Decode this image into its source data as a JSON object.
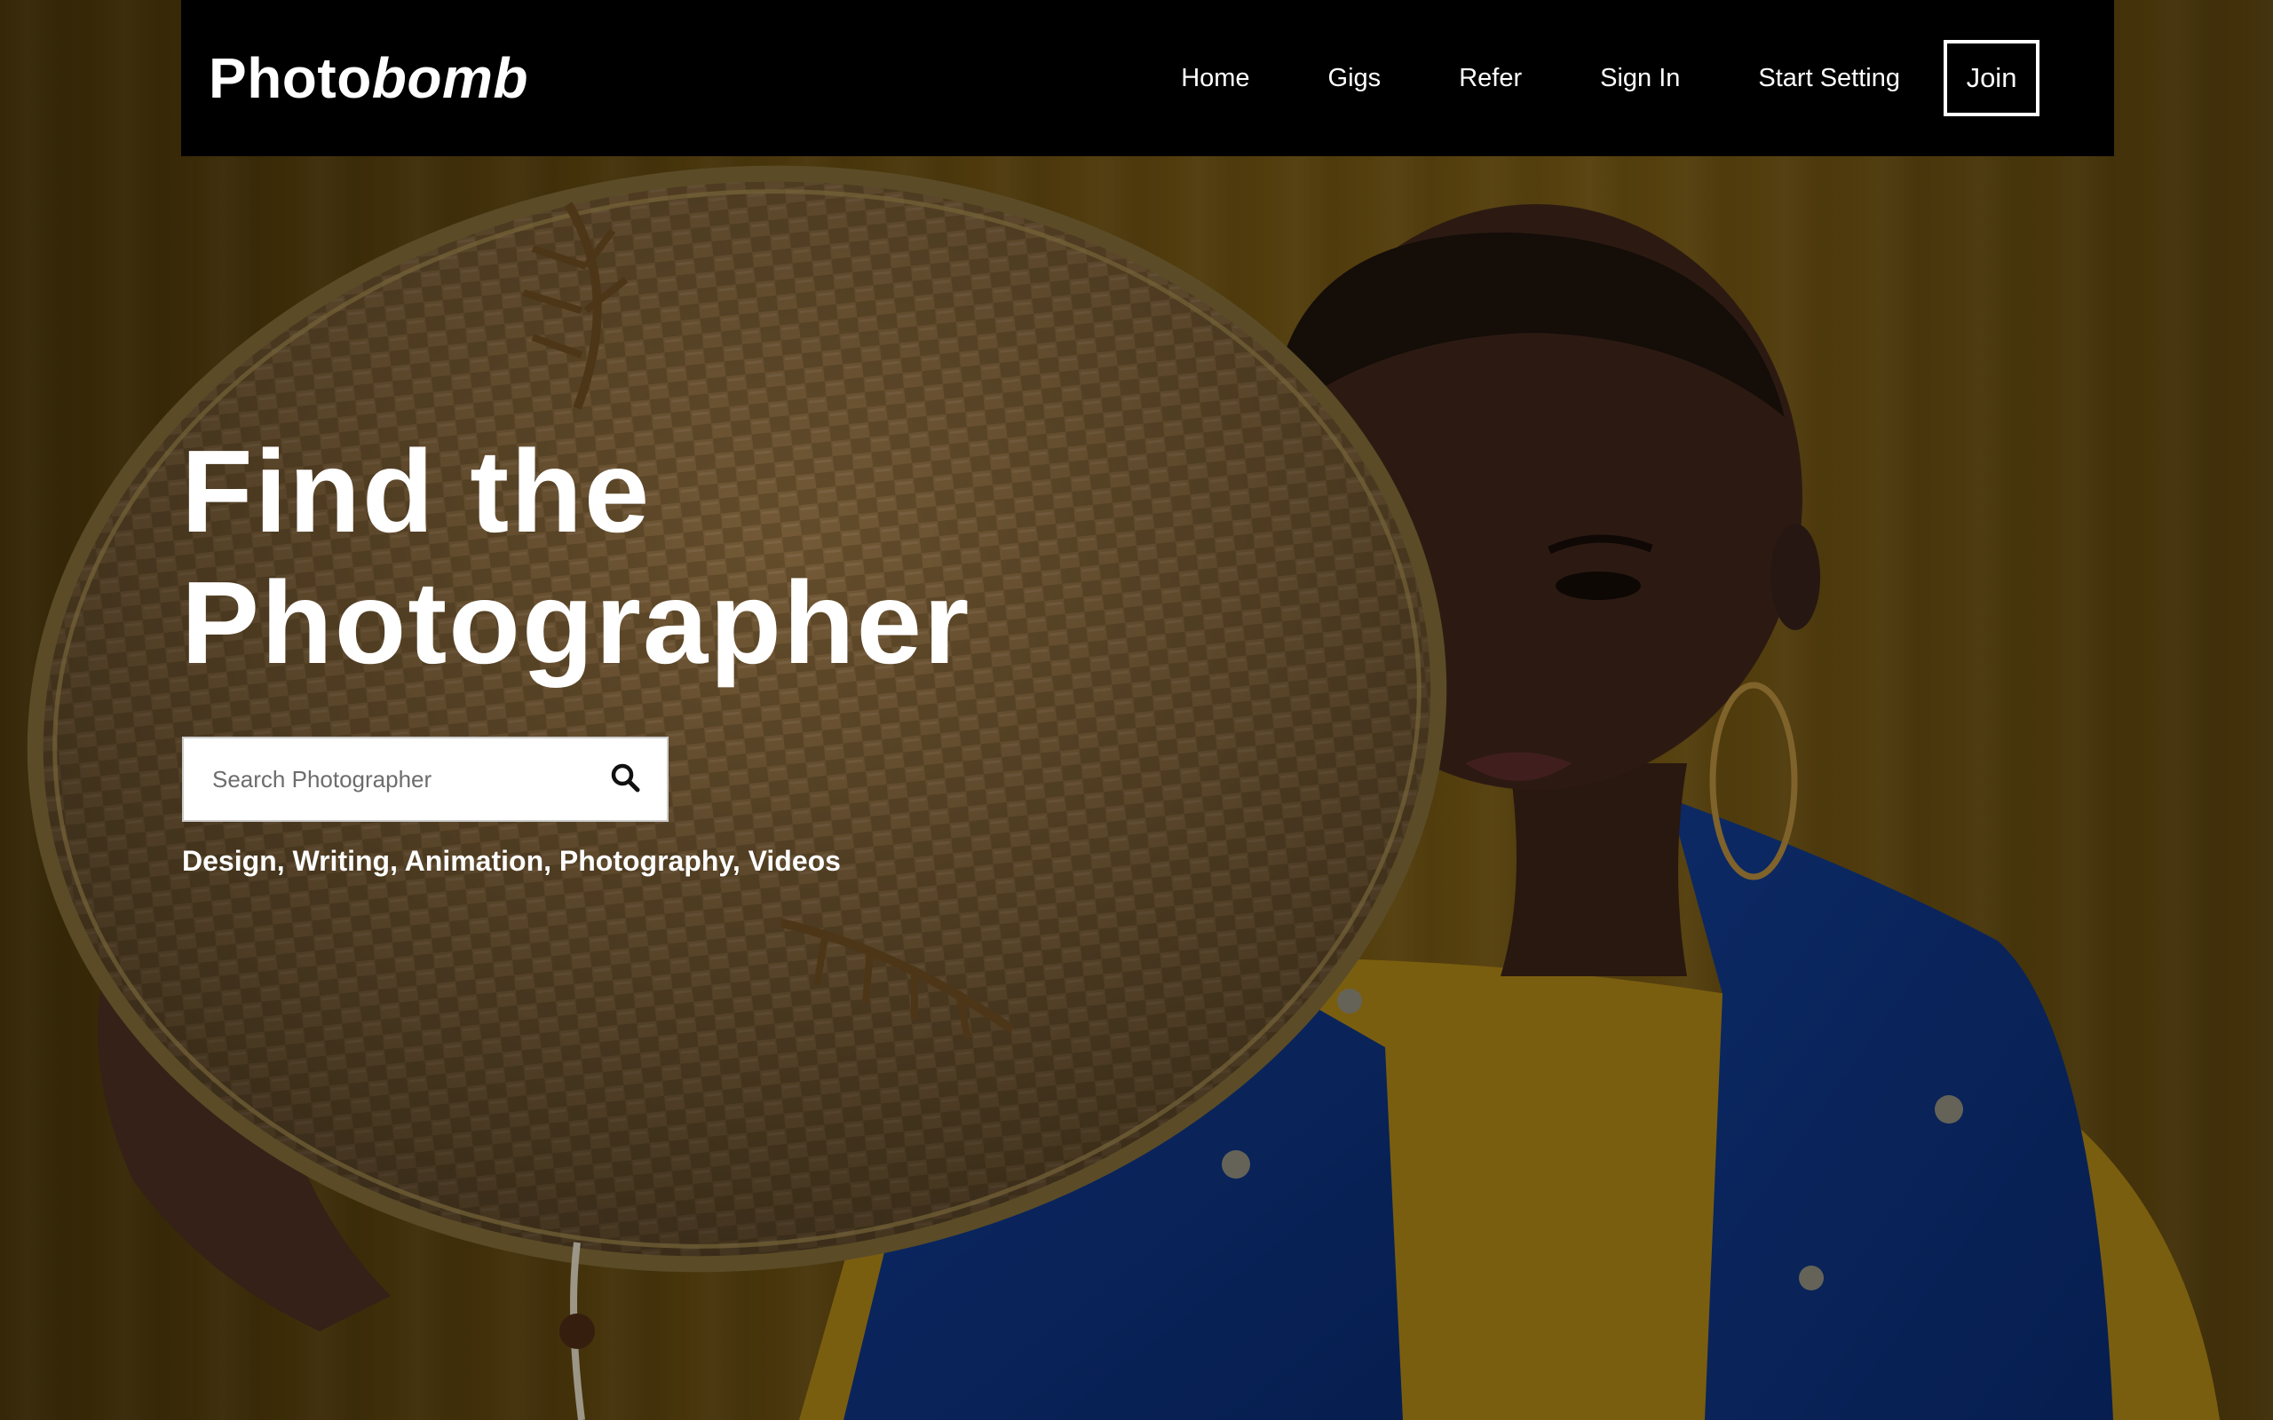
{
  "brand": {
    "name_regular": "Photo",
    "name_italic": "bomb"
  },
  "nav": {
    "items": [
      {
        "label": "Home"
      },
      {
        "label": "Gigs"
      },
      {
        "label": "Refer"
      },
      {
        "label": "Sign In"
      },
      {
        "label": "Start Setting"
      }
    ],
    "join_label": "Join"
  },
  "hero": {
    "title_line1": "Find the",
    "title_line2": "Photographer",
    "search": {
      "placeholder": "Search Photographer",
      "value": ""
    },
    "categories": "Design, Writing, Animation, Photography, Videos"
  },
  "icons": {
    "search": "search-icon"
  },
  "colors": {
    "navbar_bg": "#000000",
    "text": "#ffffff",
    "search_bg": "#ffffff",
    "background_tone": "#6b4f12"
  }
}
